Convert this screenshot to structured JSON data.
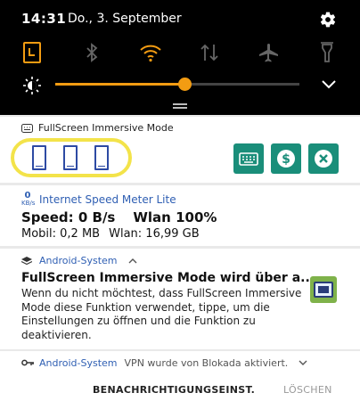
{
  "status_bar": {
    "time": "14:31",
    "date": "Do., 3. September"
  },
  "quick_settings": {
    "tiles": [
      {
        "icon": "alarm-clock-icon",
        "active": true
      },
      {
        "icon": "bluetooth-icon",
        "active": false
      },
      {
        "icon": "wifi-icon",
        "active": true
      },
      {
        "icon": "mobile-data-icon",
        "active": false
      },
      {
        "icon": "airplane-mode-icon",
        "active": false
      },
      {
        "icon": "flashlight-icon",
        "active": false
      }
    ],
    "brightness_level": 0.53,
    "accent_color": "#f39c12"
  },
  "notifications": {
    "fullscreen": {
      "app": "FullScreen Immersive Mode",
      "mode_icons": [
        "portrait-phone-icon",
        "portrait-phone-icon",
        "portrait-phone-icon"
      ],
      "action_icons": [
        "keyboard-icon",
        "dollar-icon",
        "close-icon"
      ],
      "button_color": "#1a8e7a"
    },
    "speed": {
      "icon_value": "0",
      "icon_unit": "KB/s",
      "app": "Internet Speed Meter Lite",
      "speed_label": "Speed: 0 B/s",
      "wlan_pct": "Wlan 100%",
      "mobile": "Mobil: 0,2 MB",
      "wlan_usage": "Wlan: 16,99 GB"
    },
    "android": {
      "app": "Android-System",
      "title": "FullScreen Immersive Mode wird über a..",
      "body": "Wenn du nicht möchtest, dass FullScreen Immersive Mode diese Funktion verwendet, tippe, um die Einstellungen zu öffnen und die Funktion zu deaktivieren."
    },
    "vpn": {
      "app": "Android-System",
      "text": "VPN wurde von Blokada aktiviert."
    }
  },
  "footer": {
    "settings_label": "BENACHRICHTIGUNGSEINST.",
    "clear_label": "LÖSCHEN"
  }
}
